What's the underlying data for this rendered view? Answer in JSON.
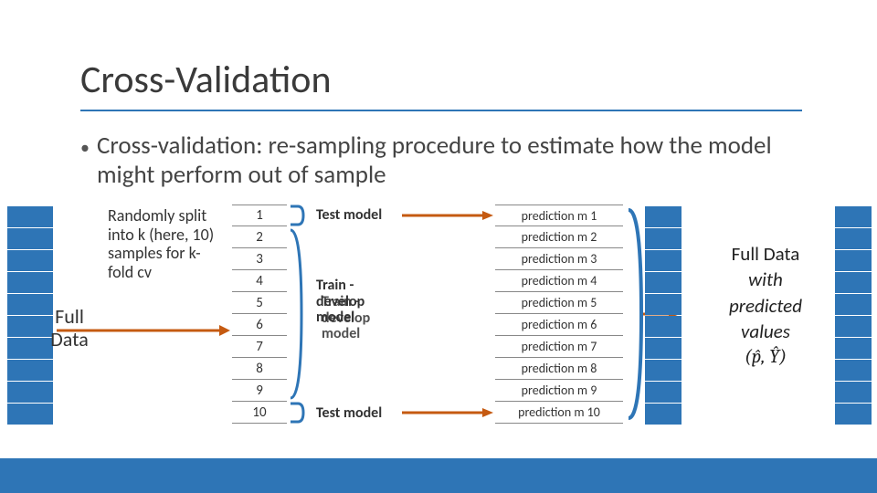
{
  "title": "Cross-Validation",
  "body": {
    "bullet_dot": "•",
    "text": "Cross-validation: re-sampling procedure to estimate how the model might perform out of sample"
  },
  "diagram": {
    "full_data_label": "Full Data",
    "random_text": "Randomly split into k (here, 10) samples for k-fold cv",
    "rows": [
      "1",
      "2",
      "3",
      "4",
      "5",
      "6",
      "7",
      "8",
      "9",
      "10"
    ],
    "labels": {
      "test_top": "Test model",
      "train_middle_a": "Train - develop model",
      "train_middle_b": "Train - develop model",
      "test_bottom": "Test model"
    },
    "predictions": [
      "prediction m 1",
      "prediction m 2",
      "prediction m 3",
      "prediction m 4",
      "prediction m 5",
      "prediction m 6",
      "prediction m 7",
      "prediction m 8",
      "prediction m 9",
      "prediction m 10"
    ],
    "result": {
      "line1": "Full Data",
      "line2_prefix": "with",
      "line3": "predicted",
      "line4": "values",
      "math": "(p̂, Ŷ)"
    }
  }
}
